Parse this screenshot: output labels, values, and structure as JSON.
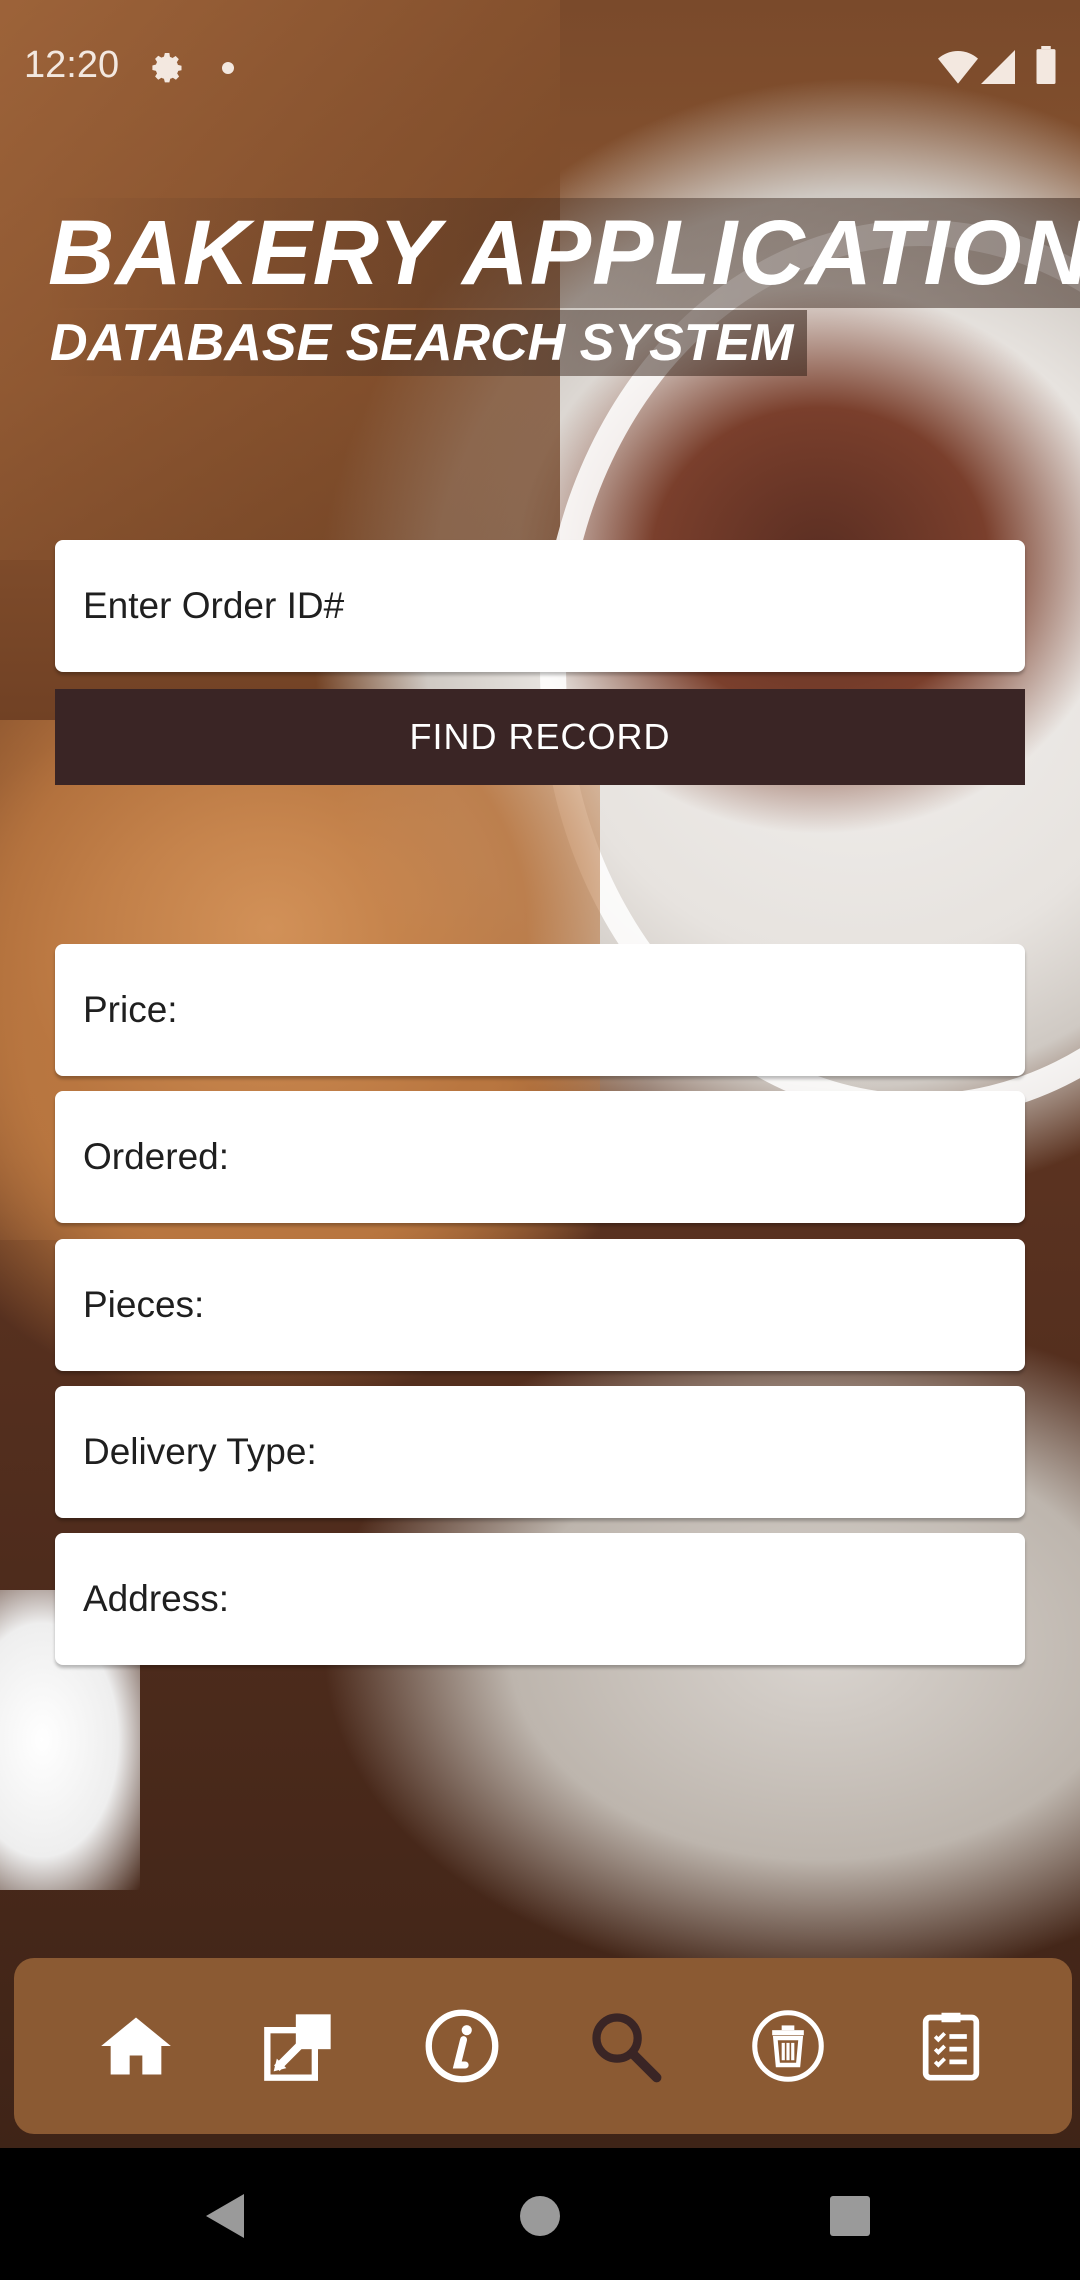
{
  "status_bar": {
    "time": "12:20"
  },
  "header": {
    "title": "BAKERY APPLICATION",
    "subtitle": "DATABASE SEARCH SYSTEM"
  },
  "search": {
    "order_id_placeholder": "Enter Order ID#",
    "find_button_label": "FIND RECORD"
  },
  "result_fields": {
    "price_label": "Price:",
    "ordered_label": "Ordered:",
    "pieces_label": "Pieces:",
    "delivery_type_label": "Delivery Type:",
    "address_label": "Address:"
  },
  "bottom_nav": {
    "items": [
      {
        "icon": "home-icon"
      },
      {
        "icon": "edit-icon"
      },
      {
        "icon": "info-icon"
      },
      {
        "icon": "search-icon",
        "active": true
      },
      {
        "icon": "trash-icon"
      },
      {
        "icon": "clipboard-list-icon"
      }
    ],
    "colors": {
      "background": "#8b5a33",
      "icon": "#ffffff",
      "active_icon": "#3a2525"
    }
  },
  "colors": {
    "button": "#3a2525",
    "nav_background": "#8b5a33"
  }
}
